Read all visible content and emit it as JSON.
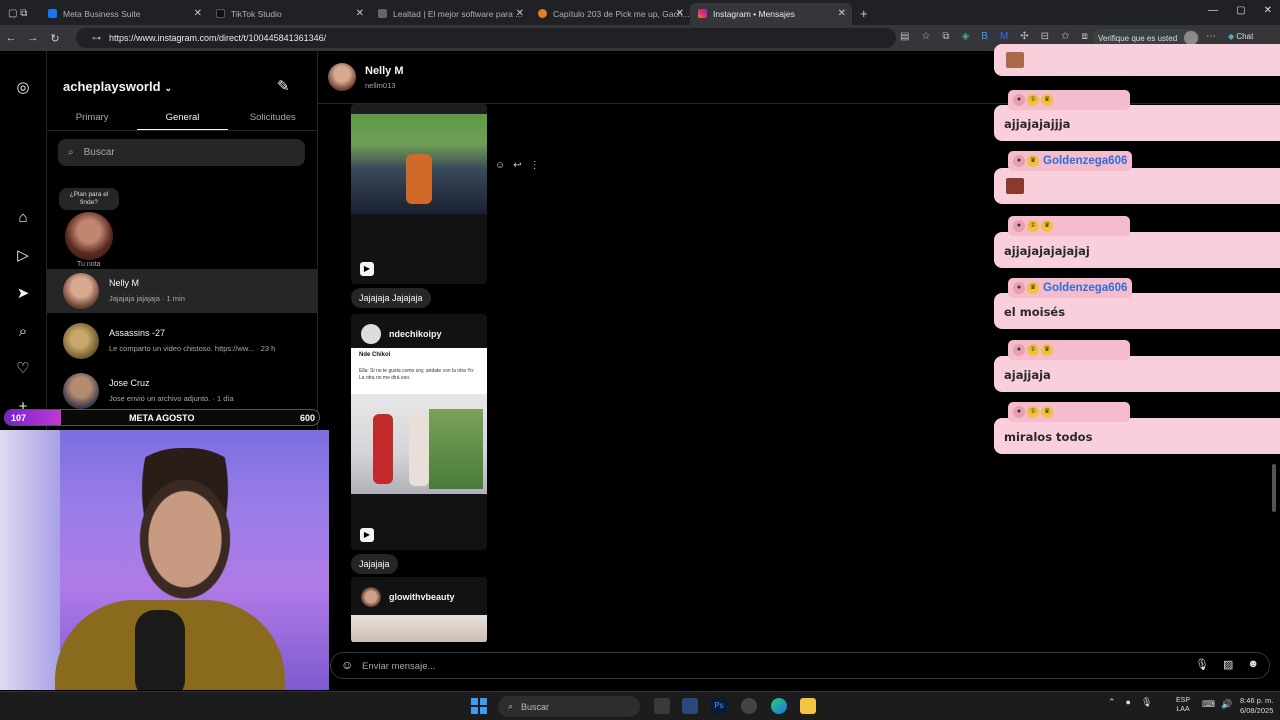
{
  "browser": {
    "tabs": [
      {
        "title": "Meta Business Suite",
        "active": false,
        "color": "#1877f2"
      },
      {
        "title": "TikTok Studio",
        "active": false,
        "color": "#111111"
      },
      {
        "title": "Lealtad | El mejor software para ...",
        "active": false,
        "color": "#666666"
      },
      {
        "title": "Capítulo 203 de Pick me up, Gach...",
        "active": false,
        "color": "#e67e22"
      },
      {
        "title": "Instagram • Mensajes",
        "active": true,
        "color": "#e1306c"
      }
    ],
    "url": "https://www.instagram.com/direct/t/100445841361346/",
    "profile_button": "Verifique que es usted",
    "chat_button": "Chat"
  },
  "inbox": {
    "account": "acheplaysworld",
    "tabs": [
      "Primary",
      "General",
      "Solicitudes"
    ],
    "active_tab": "General",
    "search_placeholder": "Buscar",
    "note_text": "¿Plan para el finde?",
    "note_label": "Tu nota",
    "threads": [
      {
        "name": "Nelly M",
        "preview": "Jajajaja jajajaja · 1 min",
        "selected": true
      },
      {
        "name": "Assassins -27",
        "preview": "Le comparto un video chistoso. https://ww... · 23 h",
        "selected": false
      },
      {
        "name": "Jose Cruz",
        "preview": "Jose envió un archivo adjunto. · 1 día",
        "selected": false
      }
    ]
  },
  "chat": {
    "name": "Nelly M",
    "username": "nellm013",
    "messages": [
      {
        "type": "text",
        "text": "Jajajaja Jajajaja"
      },
      {
        "type": "reel",
        "author": "ndechikoipy",
        "caption_name": "Nde Chikoi",
        "caption": "Ella: Si no te gusta como soy, andate con la otra   Yo: La otra no me dirá eso."
      },
      {
        "type": "text",
        "text": "Jajajaja"
      },
      {
        "type": "reel",
        "author": "glowithvbeauty"
      }
    ],
    "composer_placeholder": "Enviar mensaje..."
  },
  "overlay": {
    "goal_current": "107",
    "goal_label": "META AGOSTO",
    "goal_target": "600",
    "goal_progress": 0.178,
    "messages": [
      {
        "user": "",
        "text": "ajjajajajjja"
      },
      {
        "user": "Goldenzega606",
        "text": ""
      },
      {
        "user": "",
        "text": "ajjajajajajajaj"
      },
      {
        "user": "Goldenzega606",
        "text": "el moisés"
      },
      {
        "user": "",
        "text": "ajajjaja"
      },
      {
        "user": "",
        "text": "miralos todos"
      }
    ],
    "name_color": "#2d6fd6"
  },
  "taskbar": {
    "search_placeholder": "Buscar",
    "lang_top": "ESP",
    "lang_bottom": "LAA",
    "time": "8:46 p. m.",
    "date": "6/08/2025"
  }
}
